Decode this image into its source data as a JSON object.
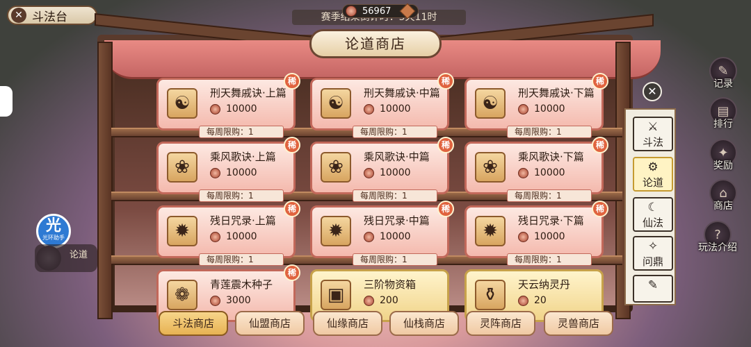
{
  "top": {
    "back_label": "斗法台",
    "currency_value": "56967",
    "season_text": "赛季结束倒计时：5天11时"
  },
  "shop": {
    "title": "论道商店",
    "items": [
      {
        "name": "刑天舞戚诀·上篇",
        "price": "10000",
        "limit": "每周限购：1",
        "rare": "稀",
        "icon": "☯",
        "style": "gold"
      },
      {
        "name": "刑天舞戚诀·中篇",
        "price": "10000",
        "limit": "每周限购：1",
        "rare": "稀",
        "icon": "☯",
        "style": "gold"
      },
      {
        "name": "刑天舞戚诀·下篇",
        "price": "10000",
        "limit": "每周限购：1",
        "rare": "稀",
        "icon": "☯",
        "style": "gold"
      },
      {
        "name": "乘风歌诀·上篇",
        "price": "10000",
        "limit": "每周限购：1",
        "rare": "稀",
        "icon": "❀",
        "style": "gold"
      },
      {
        "name": "乘风歌诀·中篇",
        "price": "10000",
        "limit": "每周限购：1",
        "rare": "稀",
        "icon": "❀",
        "style": "gold"
      },
      {
        "name": "乘风歌诀·下篇",
        "price": "10000",
        "limit": "每周限购：1",
        "rare": "稀",
        "icon": "❀",
        "style": "gold"
      },
      {
        "name": "残日咒录·上篇",
        "price": "10000",
        "limit": "每周限购：1",
        "rare": "稀",
        "icon": "✹",
        "style": "gold"
      },
      {
        "name": "残日咒录·中篇",
        "price": "10000",
        "limit": "每周限购：1",
        "rare": "稀",
        "icon": "✹",
        "style": "gold"
      },
      {
        "name": "残日咒录·下篇",
        "price": "10000",
        "limit": "每周限购：1",
        "rare": "稀",
        "icon": "✹",
        "style": "gold"
      },
      {
        "name": "青莲震木种子",
        "price": "3000",
        "limit": "",
        "rare": "稀",
        "icon": "❁",
        "style": "pink"
      },
      {
        "name": "三阶物资箱",
        "price": "200",
        "limit": "",
        "rare": "",
        "icon": "▣",
        "style": "goldcard"
      },
      {
        "name": "天云纳灵丹",
        "price": "20",
        "limit": "",
        "rare": "",
        "icon": "⚱",
        "style": "goldcard"
      }
    ]
  },
  "tabs": [
    "斗法商店",
    "仙盟商店",
    "仙缘商店",
    "仙栈商店",
    "灵阵商店",
    "灵兽商店"
  ],
  "categories": [
    {
      "label": "斗法",
      "sym": "⚔"
    },
    {
      "label": "论道",
      "sym": "⚙"
    },
    {
      "label": "仙法",
      "sym": "☾"
    },
    {
      "label": "问鼎",
      "sym": "✧"
    },
    {
      "label": "",
      "sym": "✎"
    }
  ],
  "right_nav": [
    "记录",
    "排行",
    "奖励",
    "商店",
    "玩法介绍"
  ],
  "helper": {
    "big": "光",
    "small": "光环助手"
  },
  "left_badge": "论道"
}
